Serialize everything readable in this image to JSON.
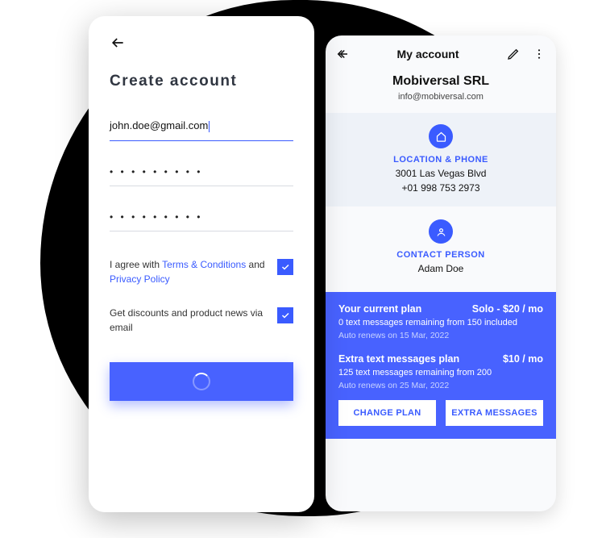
{
  "front": {
    "title": "Create account",
    "email_value": "john.doe@gmail.com",
    "password1_mask": "• • • • • • • • •",
    "password2_mask": "• • • • • • • • •",
    "consent1_prefix": "I agree with ",
    "consent1_link1": "Terms & Conditions",
    "consent1_mid": " and ",
    "consent1_link2": "Privacy Policy",
    "consent2_text": "Get discounts and product news via email",
    "consent1_checked": true,
    "consent2_checked": true
  },
  "back": {
    "title": "My account",
    "company_name": "Mobiversal SRL",
    "company_email": "info@mobiversal.com",
    "location_label": "LOCATION & PHONE",
    "address": "3001 Las Vegas Blvd",
    "phone": "+01 998 753 2973",
    "contact_label": "CONTACT PERSON",
    "contact_name": "Adam Doe",
    "plan1_title": "Your current plan",
    "plan1_price": "Solo - $20 / mo",
    "plan1_sub": "0 text messages remaining from 150 included",
    "plan1_renew": "Auto renews on 15 Mar, 2022",
    "plan2_title": "Extra text messages plan",
    "plan2_price": "$10 / mo",
    "plan2_sub": "125 text messages remaining from 200",
    "plan2_renew": "Auto renews on 25 Mar, 2022",
    "btn_change": "CHANGE PLAN",
    "btn_extra": "EXTRA MESSAGES"
  }
}
